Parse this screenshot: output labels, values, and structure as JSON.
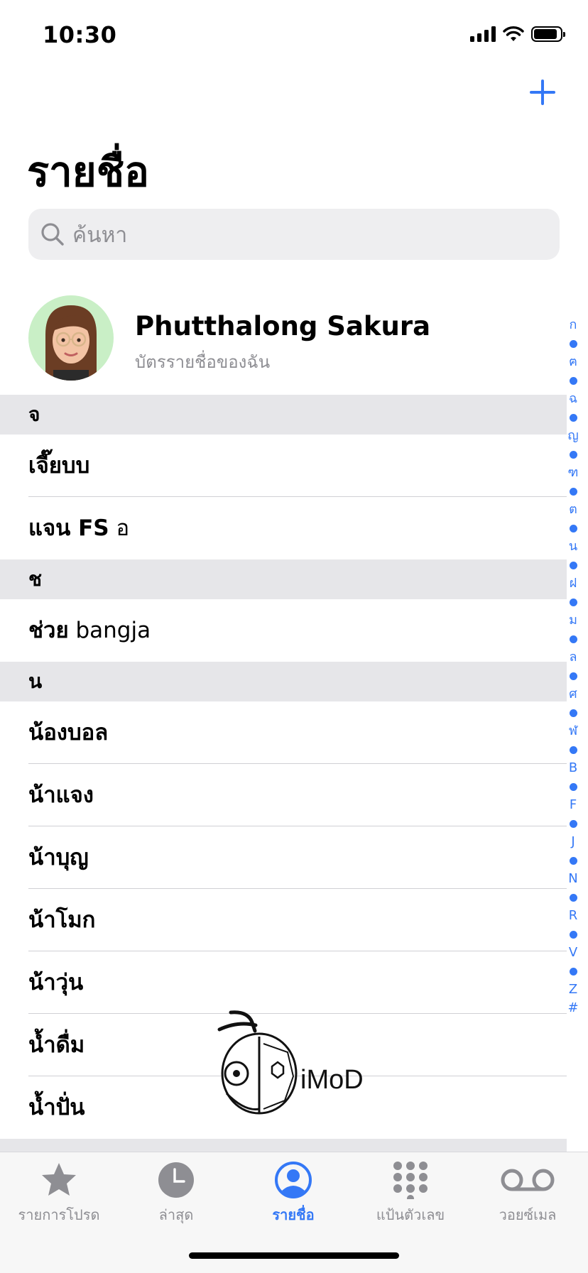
{
  "status_bar": {
    "time": "10:30"
  },
  "header": {
    "title": "รายชื่อ",
    "add_icon": "plus-icon"
  },
  "search": {
    "placeholder": "ค้นหา"
  },
  "my_card": {
    "name": "Phutthalong Sakura",
    "subtitle": "บัตรรายชื่อของฉัน"
  },
  "sections": [
    {
      "letter": "จ",
      "rows": [
        {
          "bold": "เจี๊ยบบ",
          "rest": ""
        },
        {
          "bold": "แจน FS",
          "rest": " อ"
        }
      ]
    },
    {
      "letter": "ช",
      "rows": [
        {
          "bold": "ช่วย",
          "rest": " bangja"
        }
      ]
    },
    {
      "letter": "น",
      "rows": [
        {
          "bold": "น้องบอล",
          "rest": ""
        },
        {
          "bold": "น้าแจง",
          "rest": ""
        },
        {
          "bold": "น้าบุญ",
          "rest": ""
        },
        {
          "bold": "น้าโมก",
          "rest": ""
        },
        {
          "bold": "น้าวุ่น",
          "rest": ""
        },
        {
          "bold": "น้ำดื่ม",
          "rest": ""
        },
        {
          "bold": "น้ำปั่น",
          "rest": ""
        }
      ]
    }
  ],
  "index_bar": [
    "ก",
    "•",
    "ฅ",
    "•",
    "ฉ",
    "•",
    "ญ",
    "•",
    "ฑ",
    "•",
    "ต",
    "•",
    "น",
    "•",
    "ฝ",
    "•",
    "ม",
    "•",
    "ล",
    "•",
    "ศ",
    "•",
    "ฬ",
    "•",
    "B",
    "•",
    "F",
    "•",
    "J",
    "•",
    "N",
    "•",
    "R",
    "•",
    "V",
    "•",
    "Z",
    "#"
  ],
  "watermark": {
    "text": "iMoD"
  },
  "tabs": [
    {
      "label": "รายการโปรด",
      "icon": "star-icon",
      "active": false
    },
    {
      "label": "ล่าสุด",
      "icon": "clock-icon",
      "active": false
    },
    {
      "label": "รายชื่อ",
      "icon": "person-circle-icon",
      "active": true
    },
    {
      "label": "แป้นตัวเลข",
      "icon": "keypad-icon",
      "active": false
    },
    {
      "label": "วอยซ์เมล",
      "icon": "voicemail-icon",
      "active": false
    }
  ],
  "colors": {
    "accent": "#3478f6",
    "section_bg": "#e6e6e9",
    "search_bg": "#eeeef0",
    "secondary_text": "#8e8e93"
  }
}
